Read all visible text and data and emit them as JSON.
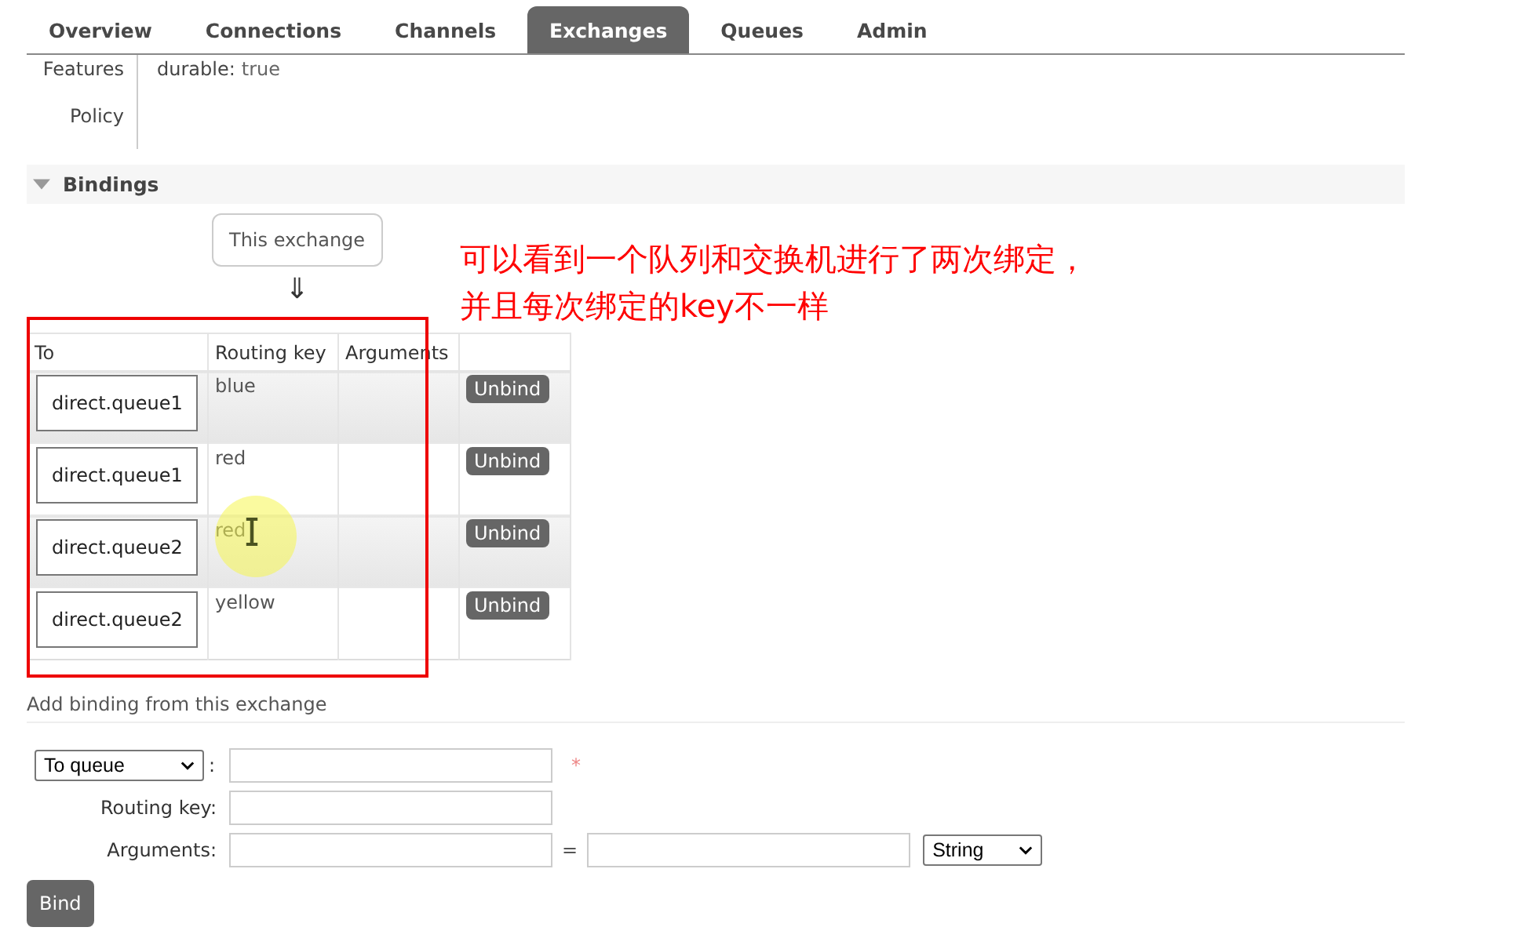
{
  "tabs": [
    {
      "label": "Overview",
      "selected": false
    },
    {
      "label": "Connections",
      "selected": false
    },
    {
      "label": "Channels",
      "selected": false
    },
    {
      "label": "Exchanges",
      "selected": true
    },
    {
      "label": "Queues",
      "selected": false
    },
    {
      "label": "Admin",
      "selected": false
    }
  ],
  "details": [
    {
      "label": "Features",
      "key": "durable:",
      "value": "true"
    },
    {
      "label": "Policy"
    }
  ],
  "bindings": {
    "title": "Bindings",
    "expanded": true,
    "source": "This exchange",
    "arrow": "⇓",
    "columns": [
      "To",
      "Routing key",
      "Arguments"
    ],
    "rows": [
      {
        "to": "direct.queue1",
        "routing_key": "blue",
        "action": "Unbind"
      },
      {
        "to": "direct.queue1",
        "routing_key": "red",
        "action": "Unbind"
      },
      {
        "to": "direct.queue2",
        "routing_key": "red",
        "action": "Unbind"
      },
      {
        "to": "direct.queue2",
        "routing_key": "yellow",
        "action": "Unbind"
      }
    ]
  },
  "annotation": {
    "lines": [
      "可以看到一个队列和交换机进行了两次绑定，",
      "并且每次绑定的key不一样"
    ]
  },
  "add_binding": {
    "title": "Add binding from this exchange",
    "destination_type": "To queue",
    "colon": ":",
    "required_mark": "*",
    "routing_key_label": "Routing key:",
    "arguments_label": "Arguments:",
    "equals": "=",
    "argument_type": "String",
    "submit": "Bind"
  }
}
